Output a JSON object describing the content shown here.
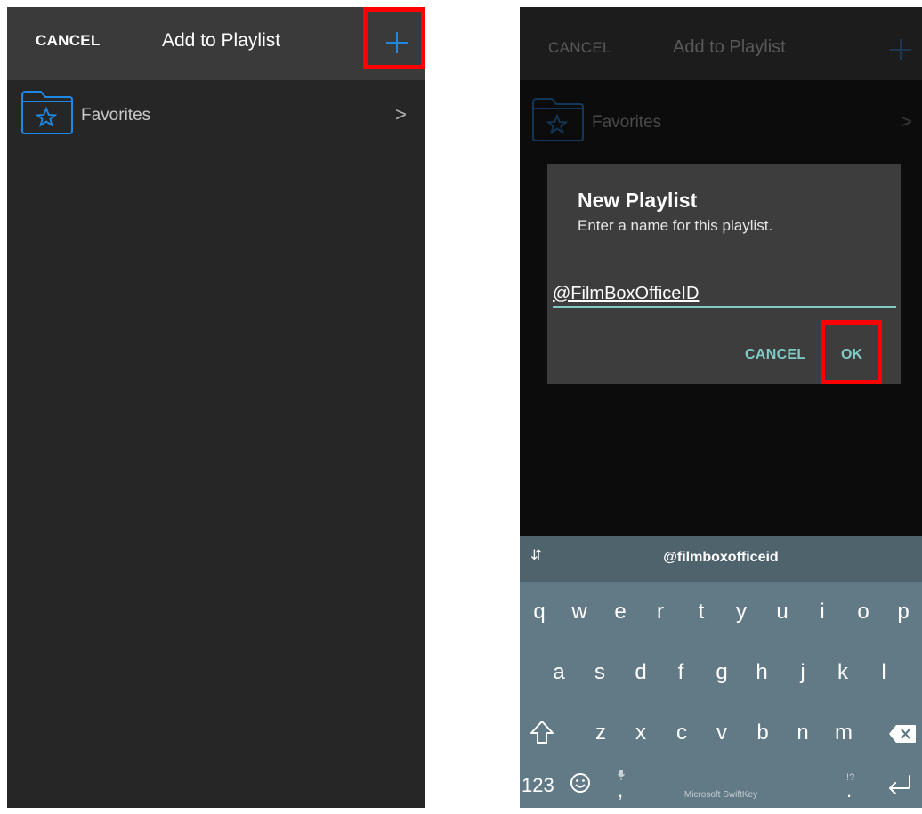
{
  "left": {
    "header": {
      "cancel_label": "CANCEL",
      "title": "Add to Playlist",
      "add_icon": "plus-icon"
    },
    "rows": [
      {
        "label": "Favorites",
        "icon": "folder-star-icon",
        "trailing_icon": "chevron-right-icon",
        "chevron": ">"
      }
    ]
  },
  "right": {
    "header": {
      "cancel_label": "CANCEL",
      "title": "Add to Playlist"
    },
    "rows": [
      {
        "label": "Favorites",
        "chevron": ">"
      }
    ],
    "dialog": {
      "title": "New Playlist",
      "message": "Enter a name for this playlist.",
      "input_value": "@FilmBoxOfficeID",
      "cancel_label": "CANCEL",
      "ok_label": "OK"
    },
    "keyboard": {
      "suggestion": "@filmboxofficeid",
      "row1": [
        "q",
        "w",
        "e",
        "r",
        "t",
        "y",
        "u",
        "i",
        "o",
        "p"
      ],
      "row2": [
        "a",
        "s",
        "d",
        "f",
        "g",
        "h",
        "j",
        "k",
        "l"
      ],
      "row3": [
        "z",
        "x",
        "c",
        "v",
        "b",
        "n",
        "m"
      ],
      "numbers_label": "123",
      "comma_label": ",",
      "period_label": ".",
      "punct_hint": ",!?",
      "brand": "Microsoft SwiftKey"
    }
  },
  "colors": {
    "accent_blue": "#1e88e5",
    "teal": "#80cbc4",
    "highlight_red": "#ff0000",
    "keyboard": "#627a86"
  }
}
